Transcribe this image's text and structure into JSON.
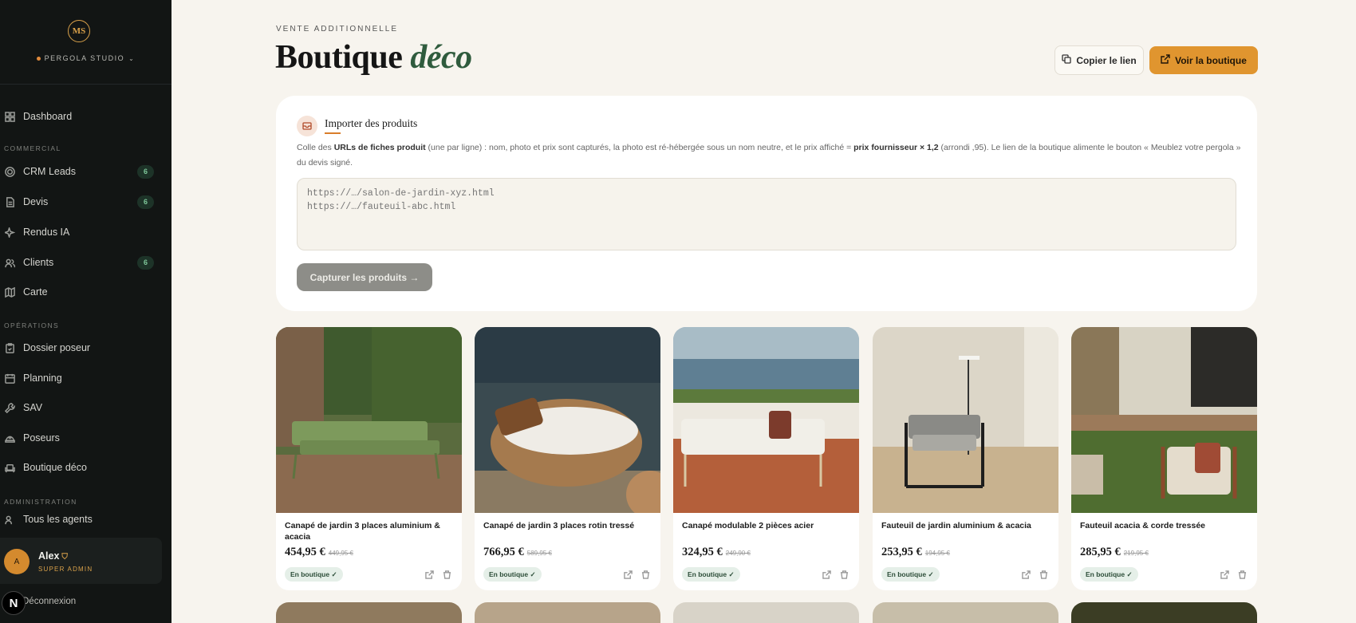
{
  "sidebar": {
    "logo": "MS",
    "studio": "PERGOLA STUDIO",
    "items": [
      {
        "label": "Dashboard",
        "icon": "dashboard-icon"
      },
      {
        "label": "CRM Leads",
        "icon": "target-icon",
        "badge": "6"
      },
      {
        "label": "Devis",
        "icon": "document-icon",
        "badge": "6"
      },
      {
        "label": "Rendus IA",
        "icon": "sparkle-icon"
      },
      {
        "label": "Clients",
        "icon": "users-icon",
        "badge": "6"
      },
      {
        "label": "Carte",
        "icon": "map-icon"
      },
      {
        "label": "Dossier poseur",
        "icon": "clipboard-icon"
      },
      {
        "label": "Planning",
        "icon": "calendar-icon"
      },
      {
        "label": "SAV",
        "icon": "wrench-icon"
      },
      {
        "label": "Poseurs",
        "icon": "hardhat-icon"
      },
      {
        "label": "Boutique déco",
        "icon": "sofa-icon"
      },
      {
        "label": "Tous les agents",
        "icon": "users-cog-icon"
      }
    ],
    "sections": [
      "COMMERCIAL",
      "OPÉRATIONS",
      "ADMINISTRATION"
    ],
    "user": {
      "initial": "A",
      "name": "Alex",
      "role": "SUPER ADMIN"
    },
    "logout": "Déconnexion",
    "n_badge": "N"
  },
  "header": {
    "kicker": "VENTE ADDITIONNELLE",
    "title_main": "Boutique",
    "title_accent": "déco",
    "copy_label": "Copier le lien",
    "shop_label": "Voir la boutique"
  },
  "import": {
    "title": "Importer des produits",
    "desc_1": "Colle des ",
    "desc_bold_1": "URLs de fiches produit",
    "desc_2": " (une par ligne) : nom, photo et prix sont capturés, la photo est ré-hébergée sous un nom neutre, et le prix affiché = ",
    "desc_bold_2": "prix fournisseur × 1,2",
    "desc_3": " (arrondi ,95). Le lien de la boutique alimente le bouton « Meublez votre pergola » du devis signé.",
    "placeholder": "https://…/salon-de-jardin-xyz.html\nhttps://…/fauteuil-abc.html",
    "capture_label": "Capturer les produits →"
  },
  "products": [
    {
      "name": "Canapé de jardin 3 places aluminium & acacia",
      "price": "454,95 €",
      "old": "449,95 €",
      "badge": "En boutique ✓"
    },
    {
      "name": "Canapé de jardin 3 places rotin tressé",
      "price": "766,95 €",
      "old": "589,95 €",
      "badge": "En boutique ✓"
    },
    {
      "name": "Canapé modulable 2 pièces acier",
      "price": "324,95 €",
      "old": "249,90 €",
      "badge": "En boutique ✓"
    },
    {
      "name": "Fauteuil de jardin aluminium & acacia",
      "price": "253,95 €",
      "old": "194,95 €",
      "badge": "En boutique ✓"
    },
    {
      "name": "Fauteuil acacia & corde tressée",
      "price": "285,95 €",
      "old": "219,95 €",
      "badge": "En boutique ✓"
    }
  ],
  "colors": {
    "accent": "#e0952f",
    "brand_green": "#2f5b3d",
    "sidebar": "#121514"
  }
}
